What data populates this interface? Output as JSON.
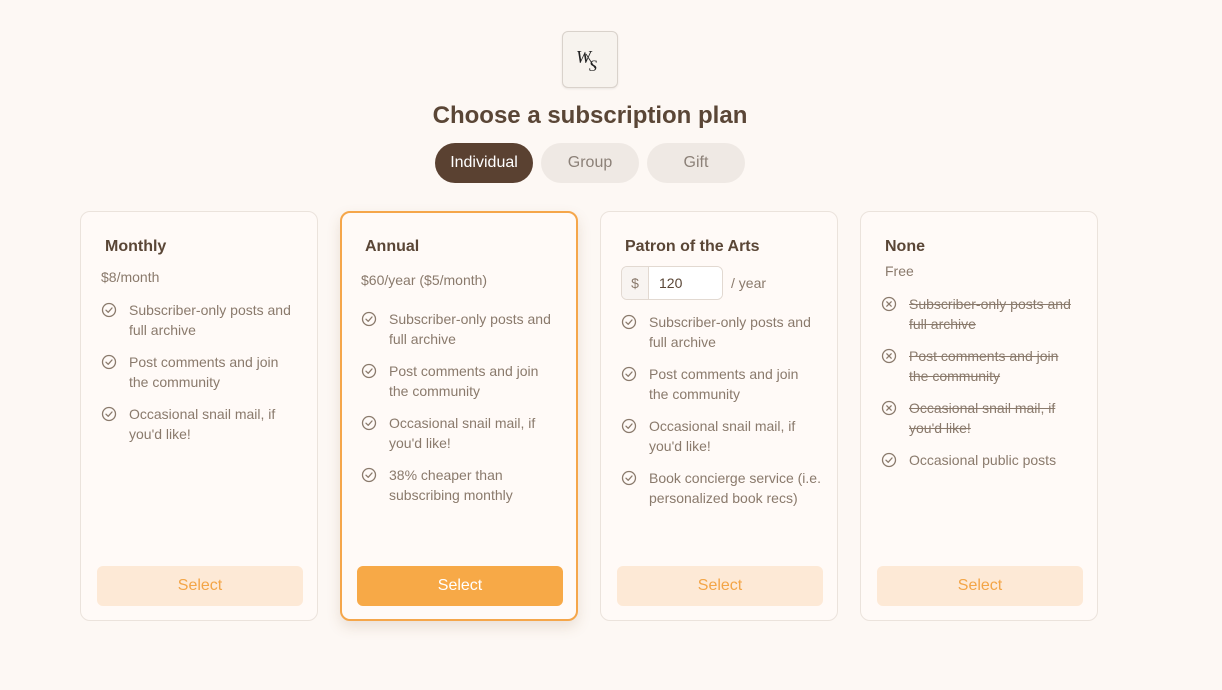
{
  "header": {
    "logo_text": "WS",
    "title": "Choose a subscription plan"
  },
  "tabs": [
    {
      "label": "Individual",
      "active": true
    },
    {
      "label": "Group",
      "active": false
    },
    {
      "label": "Gift",
      "active": false
    }
  ],
  "plans": [
    {
      "name": "Monthly",
      "price": "$8/month",
      "features": [
        {
          "text": "Subscriber-only posts and full archive",
          "icon": "check-circle-icon"
        },
        {
          "text": "Post comments and join the community",
          "icon": "check-circle-icon"
        },
        {
          "text": "Occasional snail mail, if you'd like!",
          "icon": "check-circle-icon"
        }
      ],
      "button": "Select"
    },
    {
      "name": "Annual",
      "price": "$60/year ($5/month)",
      "features": [
        {
          "text": "Subscriber-only posts and full archive",
          "icon": "check-circle-icon"
        },
        {
          "text": "Post comments and join the community",
          "icon": "check-circle-icon"
        },
        {
          "text": "Occasional snail mail, if you'd like!",
          "icon": "check-circle-icon"
        },
        {
          "text": "38% cheaper than subscribing monthly",
          "icon": "check-circle-icon"
        }
      ],
      "button": "Select",
      "highlighted": true
    },
    {
      "name": "Patron of the Arts",
      "amount": {
        "currency": "$",
        "value": "120",
        "period": "/ year"
      },
      "features": [
        {
          "text": "Subscriber-only posts and full archive",
          "icon": "check-circle-icon"
        },
        {
          "text": "Post comments and join the community",
          "icon": "check-circle-icon"
        },
        {
          "text": "Occasional snail mail, if you'd like!",
          "icon": "check-circle-icon"
        },
        {
          "text": "Book concierge service (i.e. personalized book recs)",
          "icon": "check-circle-icon"
        }
      ],
      "button": "Select"
    },
    {
      "name": "None",
      "price": "Free",
      "features": [
        {
          "text": "Subscriber-only posts and full archive",
          "icon": "x-circle-icon",
          "excluded": true
        },
        {
          "text": "Post comments and join the community",
          "icon": "x-circle-icon",
          "excluded": true
        },
        {
          "text": "Occasional snail mail, if you'd like!",
          "icon": "x-circle-icon",
          "excluded": true
        },
        {
          "text": "Occasional public posts",
          "icon": "check-circle-icon"
        }
      ],
      "button": "Select"
    }
  ],
  "colors": {
    "background": "#fdf8f4",
    "accent": "#f7a947",
    "accent_light": "#fde9d6",
    "brand_dark": "#5a4131",
    "text_muted": "#8a7a6c"
  }
}
